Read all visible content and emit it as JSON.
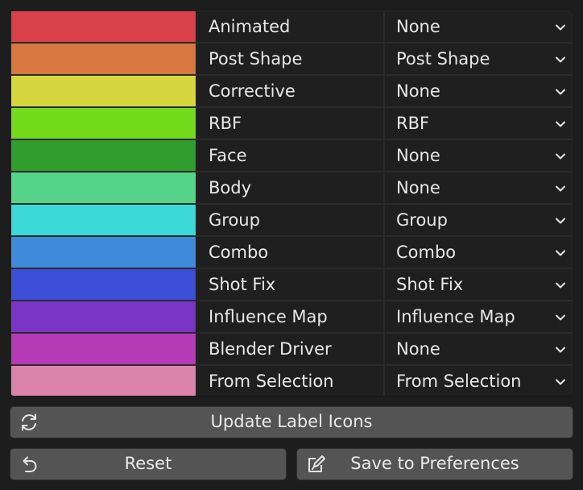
{
  "rows": [
    {
      "color": "#d9404a",
      "label": "Animated",
      "value": "None"
    },
    {
      "color": "#d87740",
      "label": "Post Shape",
      "value": "Post Shape"
    },
    {
      "color": "#d6d63f",
      "label": "Corrective",
      "value": "None"
    },
    {
      "color": "#74da1c",
      "label": "RBF",
      "value": "RBF"
    },
    {
      "color": "#2f9e2f",
      "label": "Face",
      "value": "None"
    },
    {
      "color": "#56d48a",
      "label": "Body",
      "value": "None"
    },
    {
      "color": "#3dd8d8",
      "label": "Group",
      "value": "Group"
    },
    {
      "color": "#3f8ad9",
      "label": "Combo",
      "value": "Combo"
    },
    {
      "color": "#3d4ed8",
      "label": "Shot Fix",
      "value": "Shot Fix"
    },
    {
      "color": "#7a35c6",
      "label": "Influence Map",
      "value": "Influence Map"
    },
    {
      "color": "#b53ab6",
      "label": "Blender Driver",
      "value": "None"
    },
    {
      "color": "#dc83ac",
      "label": "From Selection",
      "value": "From Selection"
    }
  ],
  "buttons": {
    "update_label": "Update Label Icons",
    "reset_label": "Reset",
    "save_label": "Save to Preferences"
  },
  "icons": {
    "update": "refresh-icon",
    "reset": "undo-icon",
    "save": "edit-save-icon",
    "dropdown": "chevron-down-icon"
  }
}
